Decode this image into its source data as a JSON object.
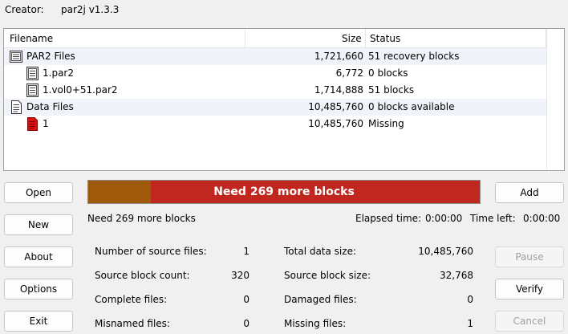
{
  "creator": {
    "label": "Creator:",
    "value": "par2j v1.3.3"
  },
  "file_list": {
    "headers": {
      "filename": "Filename",
      "size": "Size",
      "status": "Status"
    },
    "rows": [
      {
        "name": "PAR2 Files",
        "size": "1,721,660",
        "status": "51 recovery blocks",
        "icon": "par2-group-icon"
      },
      {
        "name": "1.par2",
        "size": "6,772",
        "status": "0 blocks",
        "icon": "par2-file-icon"
      },
      {
        "name": "1.vol0+51.par2",
        "size": "1,714,888",
        "status": "51 blocks",
        "icon": "par2-file-icon"
      },
      {
        "name": "Data Files",
        "size": "10,485,760",
        "status": "0 blocks available",
        "icon": "document-icon"
      },
      {
        "name": "1",
        "size": "10,485,760",
        "status": "Missing",
        "icon": "missing-file-icon"
      }
    ]
  },
  "buttons": {
    "open": "Open",
    "new": "New",
    "about": "About",
    "options": "Options",
    "exit": "Exit",
    "add": "Add",
    "pause": "Pause",
    "verify": "Verify",
    "cancel": "Cancel"
  },
  "progress": {
    "text": "Need 269 more blocks",
    "fraction": 0.16,
    "fill_color": "#a0590a",
    "track_color": "#c0271f"
  },
  "status_line": {
    "message": "Need 269 more blocks",
    "elapsed_label": "Elapsed time:",
    "elapsed_value": "0:00:00",
    "left_label": "Time left:",
    "left_value": "0:00:00"
  },
  "stats": {
    "num_source_files_label": "Number of source files:",
    "num_source_files": "1",
    "source_block_count_label": "Source block count:",
    "source_block_count": "320",
    "complete_files_label": "Complete files:",
    "complete_files": "0",
    "misnamed_files_label": "Misnamed files:",
    "misnamed_files": "0",
    "total_data_size_label": "Total data size:",
    "total_data_size": "10,485,760",
    "source_block_size_label": "Source block size:",
    "source_block_size": "32,768",
    "damaged_files_label": "Damaged files:",
    "damaged_files": "0",
    "missing_files_label": "Missing files:",
    "missing_files": "1"
  }
}
